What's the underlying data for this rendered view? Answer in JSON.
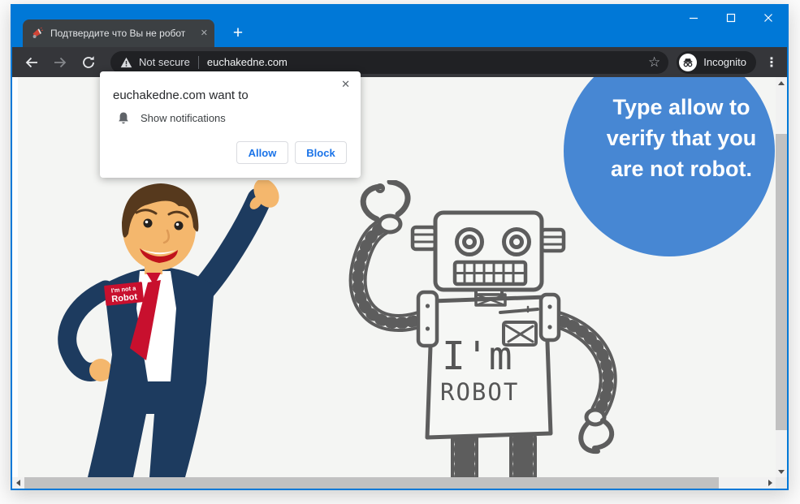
{
  "tab_strip": {
    "tab_title": "Подтвердите что Вы не робот",
    "close_glyph": "✕",
    "new_tab_glyph": "+"
  },
  "toolbar": {
    "not_secure_label": "Not secure",
    "url": "euchakedne.com",
    "incognito_label": "Incognito",
    "star_glyph": "☆",
    "menu_glyph": "⋮"
  },
  "permission_dialog": {
    "title": "euchakedne.com want to",
    "permission": "Show notifications",
    "allow_label": "Allow",
    "block_label": "Block",
    "close_glyph": "✕"
  },
  "page": {
    "bubble": {
      "line1": "Type allow to",
      "line2": "verify that you",
      "line3": "are not robot."
    },
    "badge": {
      "line1": "I'm not a",
      "line2": "Robot"
    },
    "robot_text": {
      "line1": "I'm",
      "line2": "ROBOT"
    }
  },
  "icons": {
    "favicon": "red-megaphone",
    "not_secure": "warning-triangle",
    "permission": "bell"
  },
  "colors": {
    "titlebar_blue": "#0078d7",
    "toolbar_dark": "#35363a",
    "tab_dark": "#3c4043",
    "omnibox_dark": "#202124",
    "page_bg": "#f4f5f3",
    "bubble_blue": "#4787d3",
    "link_blue": "#1a73e8",
    "badge_red": "#c8102e",
    "suit_navy": "#1d3b5f",
    "skin": "#f4b76d",
    "sketch_gray": "#5d5d5d"
  }
}
